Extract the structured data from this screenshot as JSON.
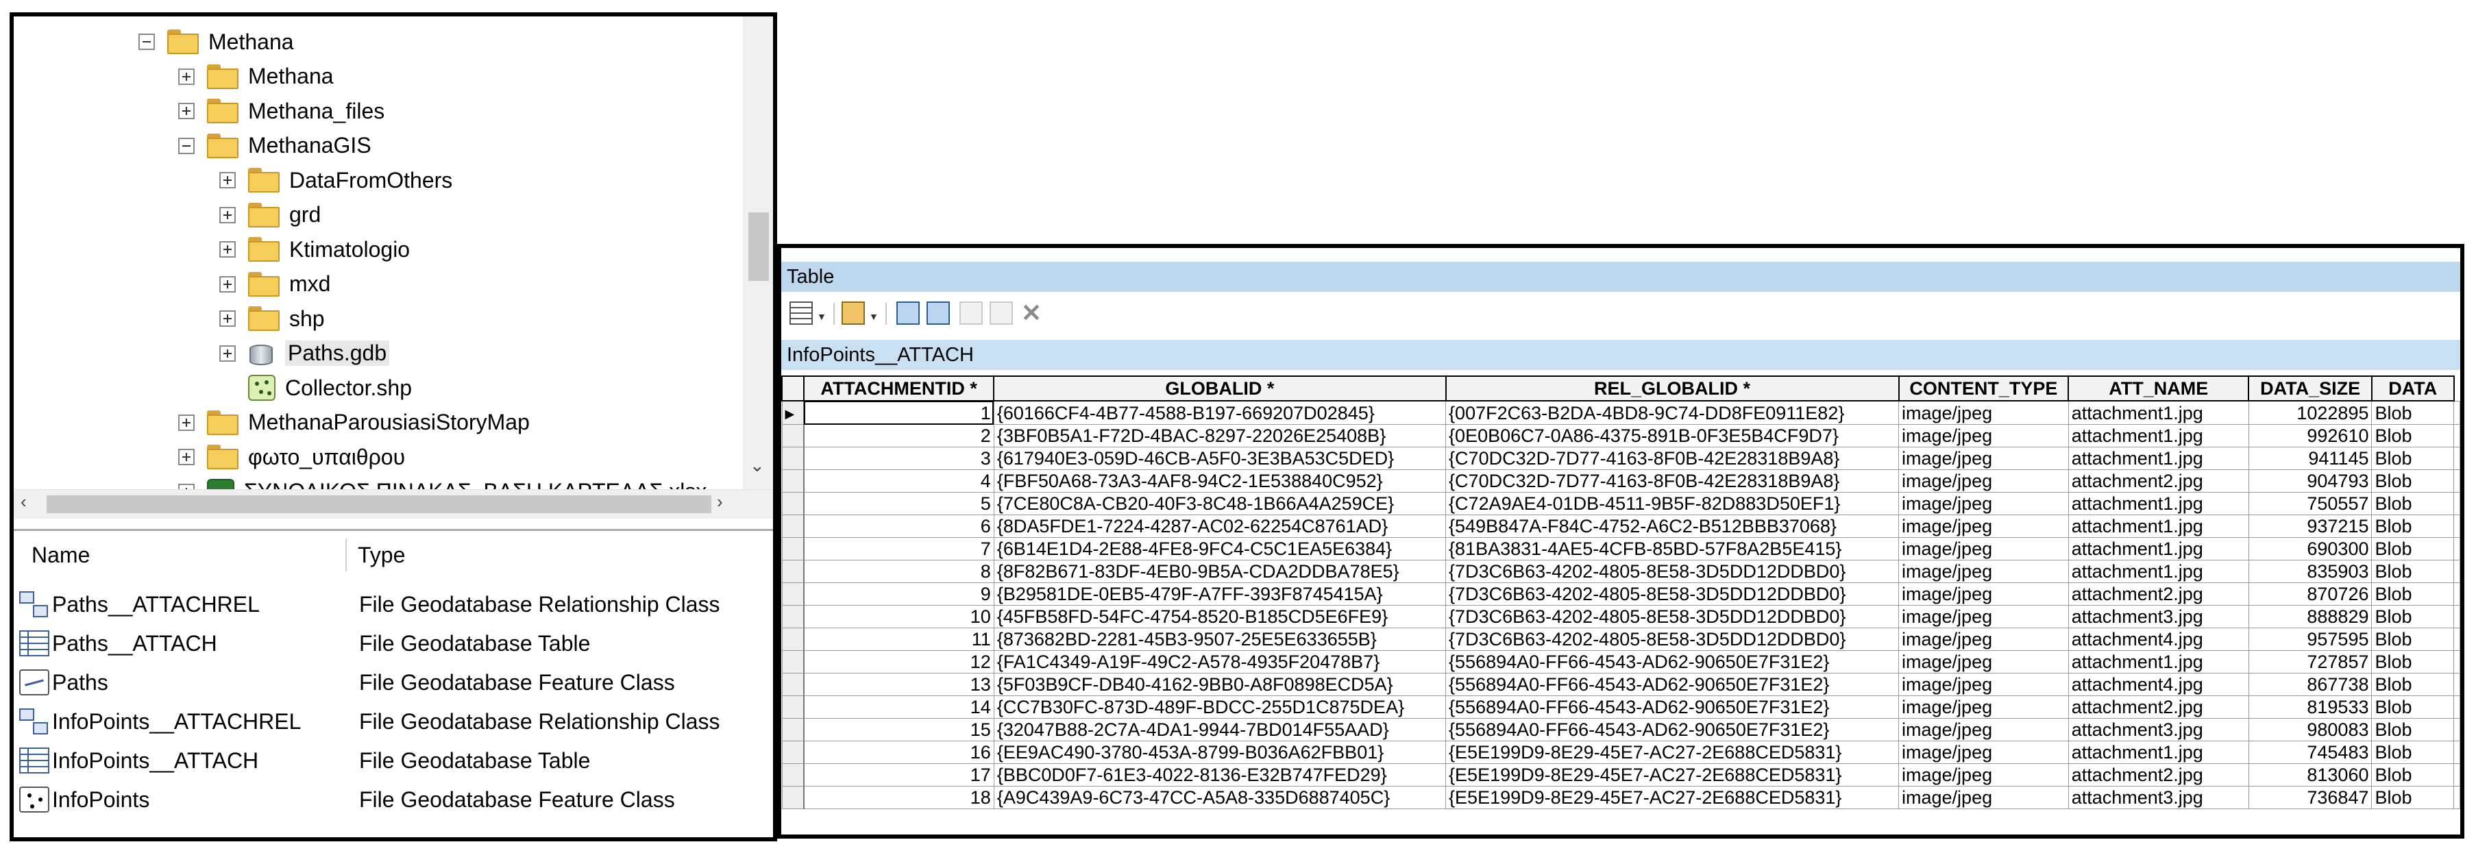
{
  "tree": {
    "nodes": [
      {
        "label": "Methana",
        "level": 0,
        "expander": "minus",
        "icon": "folder-icon"
      },
      {
        "label": "Methana",
        "level": 1,
        "expander": "plus",
        "icon": "folder-icon"
      },
      {
        "label": "Methana_files",
        "level": 1,
        "expander": "plus",
        "icon": "folder-icon"
      },
      {
        "label": "MethanaGIS",
        "level": 1,
        "expander": "minus",
        "icon": "folder-icon"
      },
      {
        "label": "DataFromOthers",
        "level": 2,
        "expander": "plus",
        "icon": "folder-icon"
      },
      {
        "label": "grd",
        "level": 2,
        "expander": "plus",
        "icon": "folder-icon"
      },
      {
        "label": "Ktimatologio",
        "level": 2,
        "expander": "plus",
        "icon": "folder-icon"
      },
      {
        "label": "mxd",
        "level": 2,
        "expander": "plus",
        "icon": "folder-icon"
      },
      {
        "label": "shp",
        "level": 2,
        "expander": "plus",
        "icon": "folder-icon"
      },
      {
        "label": "Paths.gdb",
        "level": 2,
        "expander": "plus",
        "icon": "geodatabase-icon",
        "selected": true
      },
      {
        "label": "Collector.shp",
        "level": 2,
        "expander": "none",
        "icon": "shapefile-icon"
      },
      {
        "label": "MethanaParousiasiStoryMap",
        "level": 1,
        "expander": "plus",
        "icon": "folder-icon"
      },
      {
        "label": "φωτο_υπαιθρου",
        "level": 1,
        "expander": "plus",
        "icon": "folder-icon"
      },
      {
        "label": "ΣΥΝΟΛΙΚΟΣ ΠΙΝΑΚΑΣ_ΒΑΣΗ ΚΑΡΤΕΛΑΣ.xlsx",
        "level": 1,
        "expander": "plus",
        "icon": "excel-icon"
      }
    ]
  },
  "contents": {
    "headers": {
      "name": "Name",
      "type": "Type"
    },
    "items": [
      {
        "name": "Paths__ATTACHREL",
        "type": "File Geodatabase Relationship Class",
        "icon": "relationship-class-icon"
      },
      {
        "name": "Paths__ATTACH",
        "type": "File Geodatabase Table",
        "icon": "table-icon"
      },
      {
        "name": "Paths",
        "type": "File Geodatabase Feature Class",
        "icon": "line-feature-class-icon"
      },
      {
        "name": "InfoPoints__ATTACHREL",
        "type": "File Geodatabase Relationship Class",
        "icon": "relationship-class-icon"
      },
      {
        "name": "InfoPoints__ATTACH",
        "type": "File Geodatabase Table",
        "icon": "table-icon"
      },
      {
        "name": "InfoPoints",
        "type": "File Geodatabase Feature Class",
        "icon": "point-feature-class-icon"
      }
    ]
  },
  "table_window": {
    "title": "Table",
    "tab": "InfoPoints__ATTACH",
    "columns": [
      "ATTACHMENTID *",
      "GLOBALID *",
      "REL_GLOBALID *",
      "CONTENT_TYPE",
      "ATT_NAME",
      "DATA_SIZE",
      "DATA"
    ],
    "rows": [
      [
        "1",
        "{60166CF4-4B77-4588-B197-669207D02845}",
        "{007F2C63-B2DA-4BD8-9C74-DD8FE0911E82}",
        "image/jpeg",
        "attachment1.jpg",
        "1022895",
        "Blob"
      ],
      [
        "2",
        "{3BF0B5A1-F72D-4BAC-8297-22026E25408B}",
        "{0E0B06C7-0A86-4375-891B-0F3E5B4CF9D7}",
        "image/jpeg",
        "attachment1.jpg",
        "992610",
        "Blob"
      ],
      [
        "3",
        "{617940E3-059D-46CB-A5F0-3E3BA53C5DED}",
        "{C70DC32D-7D77-4163-8F0B-42E28318B9A8}",
        "image/jpeg",
        "attachment1.jpg",
        "941145",
        "Blob"
      ],
      [
        "4",
        "{FBF50A68-73A3-4AF8-94C2-1E538840C952}",
        "{C70DC32D-7D77-4163-8F0B-42E28318B9A8}",
        "image/jpeg",
        "attachment2.jpg",
        "904793",
        "Blob"
      ],
      [
        "5",
        "{7CE80C8A-CB20-40F3-8C48-1B66A4A259CE}",
        "{C72A9AE4-01DB-4511-9B5F-82D883D50EF1}",
        "image/jpeg",
        "attachment1.jpg",
        "750557",
        "Blob"
      ],
      [
        "6",
        "{8DA5FDE1-7224-4287-AC02-62254C8761AD}",
        "{549B847A-F84C-4752-A6C2-B512BBB37068}",
        "image/jpeg",
        "attachment1.jpg",
        "937215",
        "Blob"
      ],
      [
        "7",
        "{6B14E1D4-2E88-4FE8-9FC4-C5C1EA5E6384}",
        "{81BA3831-4AE5-4CFB-85BD-57F8A2B5E415}",
        "image/jpeg",
        "attachment1.jpg",
        "690300",
        "Blob"
      ],
      [
        "8",
        "{8F82B671-83DF-4EB0-9B5A-CDA2DDBA78E5}",
        "{7D3C6B63-4202-4805-8E58-3D5DD12DDBD0}",
        "image/jpeg",
        "attachment1.jpg",
        "835903",
        "Blob"
      ],
      [
        "9",
        "{B29581DE-0EB5-479F-A7FF-393F8745415A}",
        "{7D3C6B63-4202-4805-8E58-3D5DD12DDBD0}",
        "image/jpeg",
        "attachment2.jpg",
        "870726",
        "Blob"
      ],
      [
        "10",
        "{45FB58FD-54FC-4754-8520-B185CD5E6FE9}",
        "{7D3C6B63-4202-4805-8E58-3D5DD12DDBD0}",
        "image/jpeg",
        "attachment3.jpg",
        "888829",
        "Blob"
      ],
      [
        "11",
        "{873682BD-2281-45B3-9507-25E5E633655B}",
        "{7D3C6B63-4202-4805-8E58-3D5DD12DDBD0}",
        "image/jpeg",
        "attachment4.jpg",
        "957595",
        "Blob"
      ],
      [
        "12",
        "{FA1C4349-A19F-49C2-A578-4935F20478B7}",
        "{556894A0-FF66-4543-AD62-90650E7F31E2}",
        "image/jpeg",
        "attachment1.jpg",
        "727857",
        "Blob"
      ],
      [
        "13",
        "{5F03B9CF-DB40-4162-9BB0-A8F0898ECD5A}",
        "{556894A0-FF66-4543-AD62-90650E7F31E2}",
        "image/jpeg",
        "attachment4.jpg",
        "867738",
        "Blob"
      ],
      [
        "14",
        "{CC7B30FC-873D-489F-BDCC-255D1C875DEA}",
        "{556894A0-FF66-4543-AD62-90650E7F31E2}",
        "image/jpeg",
        "attachment2.jpg",
        "819533",
        "Blob"
      ],
      [
        "15",
        "{32047B88-2C7A-4DA1-9944-7BD014F55AAD}",
        "{556894A0-FF66-4543-AD62-90650E7F31E2}",
        "image/jpeg",
        "attachment3.jpg",
        "980083",
        "Blob"
      ],
      [
        "16",
        "{EE9AC490-3780-453A-8799-B036A62FBB01}",
        "{E5E199D9-8E29-45E7-AC27-2E688CED5831}",
        "image/jpeg",
        "attachment1.jpg",
        "745483",
        "Blob"
      ],
      [
        "17",
        "{BBC0D0F7-61E3-4022-8136-E32B747FED29}",
        "{E5E199D9-8E29-45E7-AC27-2E688CED5831}",
        "image/jpeg",
        "attachment2.jpg",
        "813060",
        "Blob"
      ],
      [
        "18",
        "{A9C439A9-6C73-47CC-A5A8-335D6887405C}",
        "{E5E199D9-8E29-45E7-AC27-2E688CED5831}",
        "image/jpeg",
        "attachment3.jpg",
        "736847",
        "Blob"
      ]
    ]
  },
  "colors": {
    "title_bar": "#bdd8ee",
    "tab_strip": "#c9dff2",
    "folder": "#f5cd5a"
  }
}
